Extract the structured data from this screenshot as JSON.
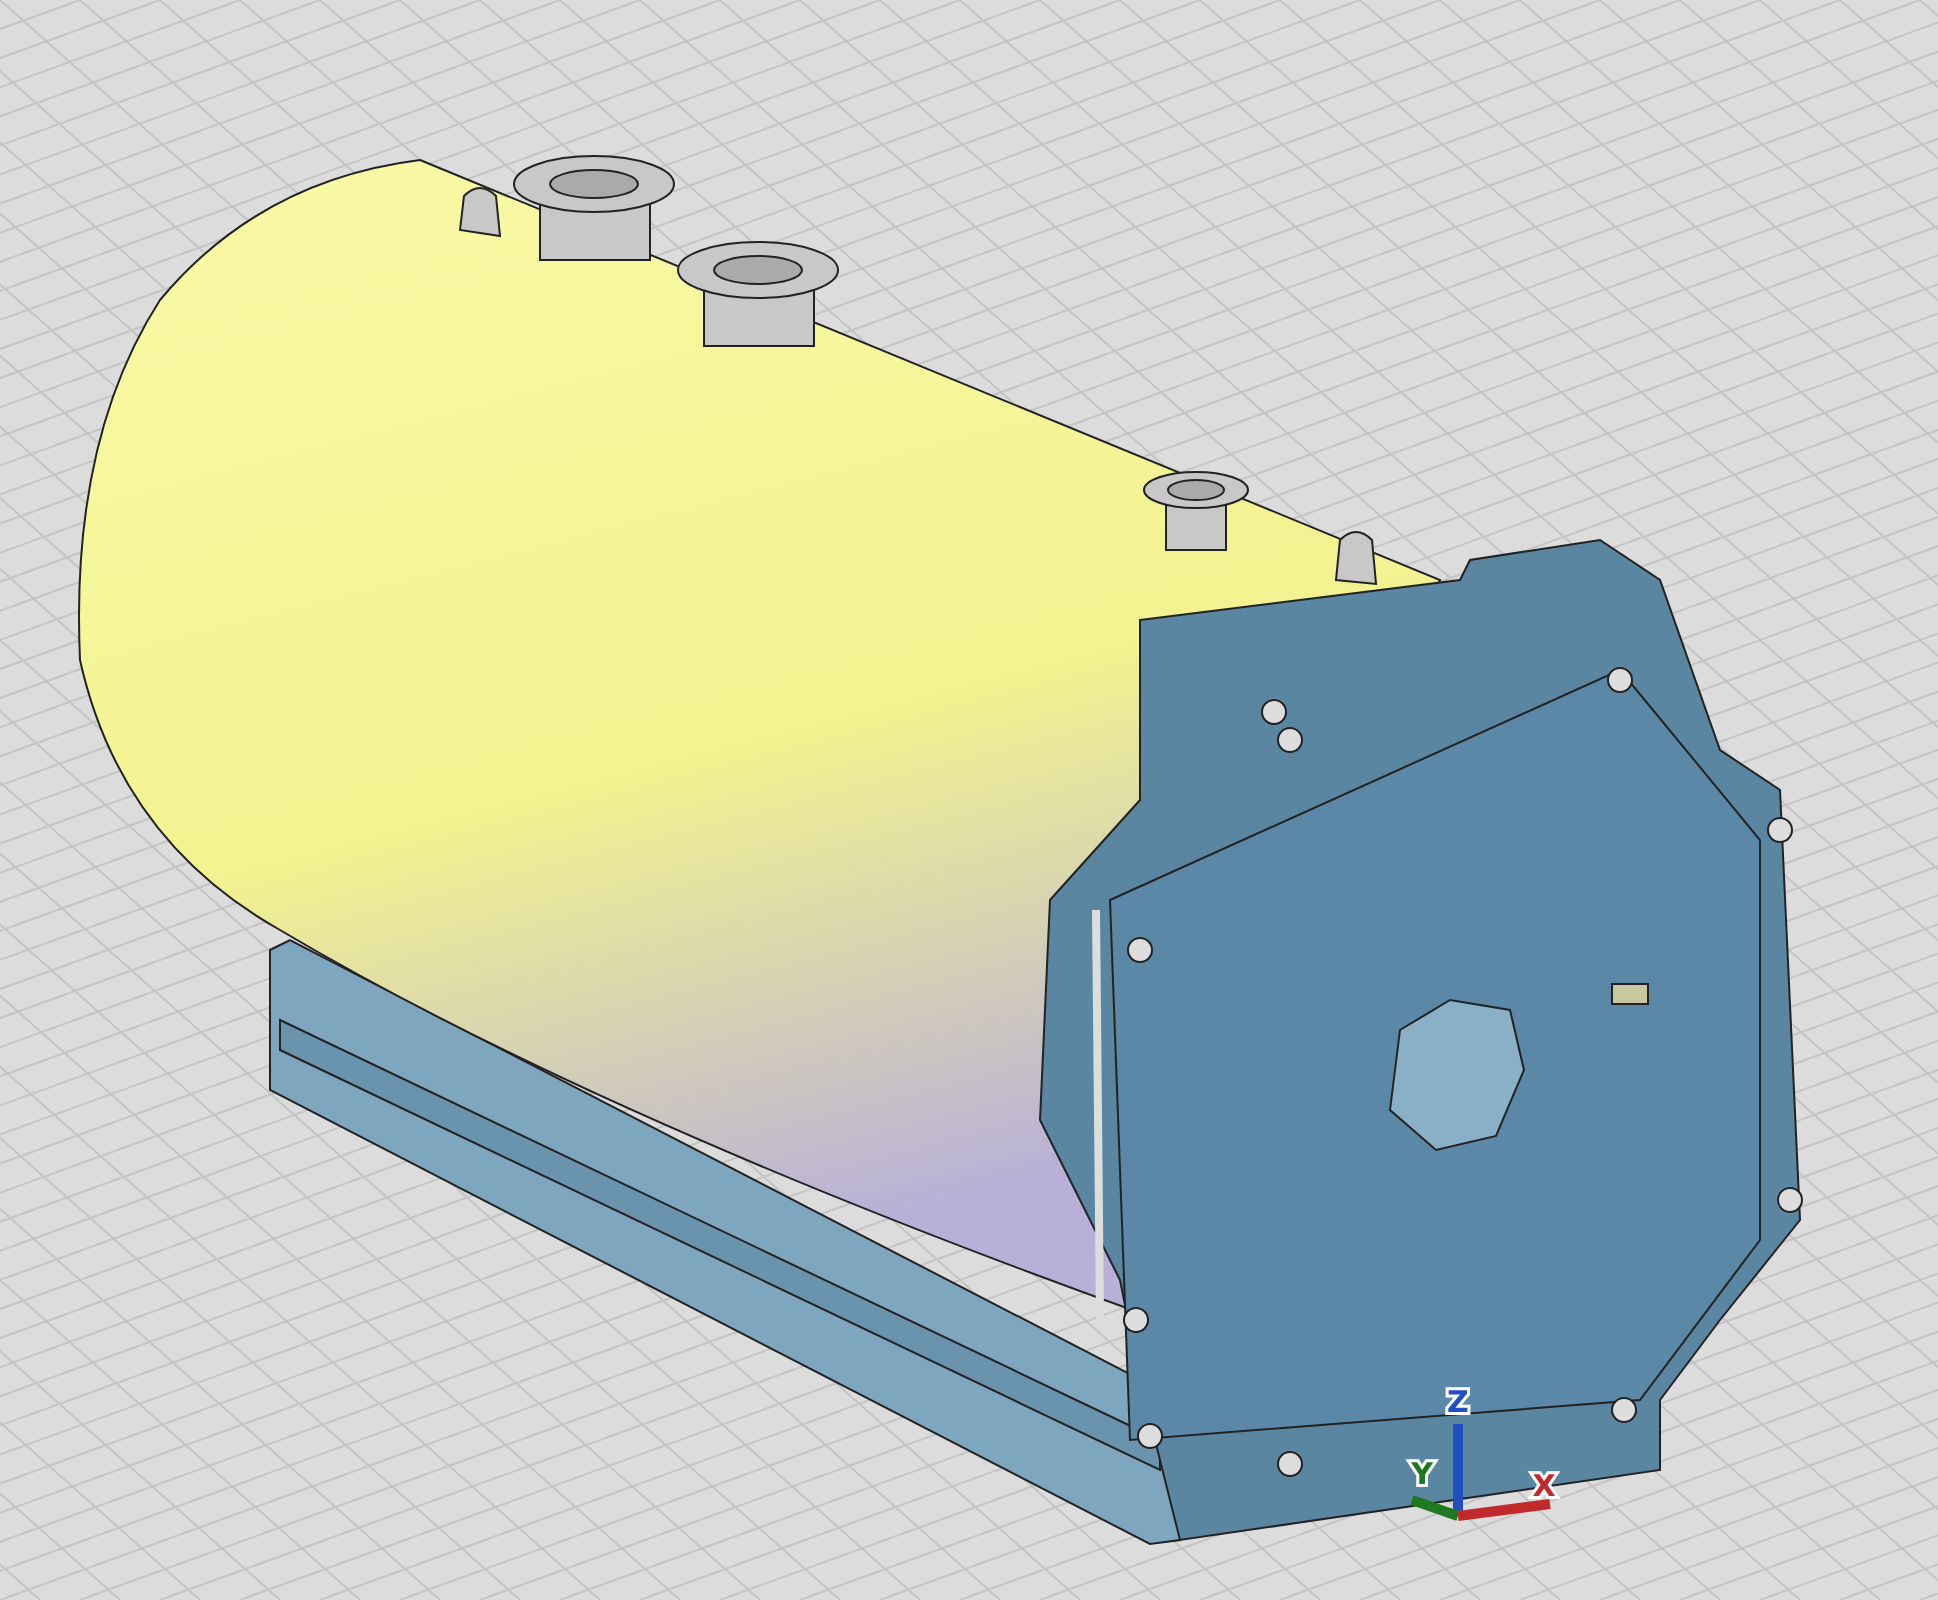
{
  "viewport": {
    "axes": [
      {
        "kind": "z",
        "label": "Z",
        "color": "#1f4fc0"
      },
      {
        "kind": "y",
        "label": "Y",
        "color": "#1f7a1f"
      },
      {
        "kind": "x",
        "label": "X",
        "color": "#c02a2a"
      }
    ]
  }
}
